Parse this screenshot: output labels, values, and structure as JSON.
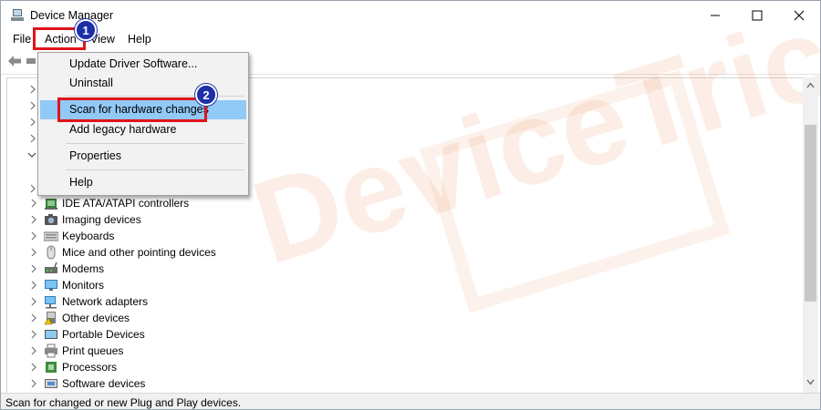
{
  "window": {
    "title": "Device Manager"
  },
  "window_controls": {
    "minimize": "—",
    "maximize": "☐",
    "close": "✕"
  },
  "menubar": {
    "items": [
      "File",
      "Action",
      "View",
      "Help"
    ]
  },
  "action_menu": {
    "items": [
      {
        "label": "Update Driver Software...",
        "highlighted": false
      },
      {
        "label": "Uninstall",
        "highlighted": false
      },
      {
        "label": "Scan for hardware changes",
        "highlighted": true
      },
      {
        "label": "Add legacy hardware",
        "highlighted": false
      },
      {
        "label": "Properties",
        "highlighted": false
      },
      {
        "label": "Help",
        "highlighted": false
      }
    ]
  },
  "callouts": {
    "step1": "1",
    "step2": "2"
  },
  "tree": {
    "items": [
      {
        "label": "IDE ATA/ATAPI controllers",
        "icon": "ide-controller-icon"
      },
      {
        "label": "Imaging devices",
        "icon": "camera-icon"
      },
      {
        "label": "Keyboards",
        "icon": "keyboard-icon"
      },
      {
        "label": "Mice and other pointing devices",
        "icon": "mouse-icon"
      },
      {
        "label": "Modems",
        "icon": "modem-icon"
      },
      {
        "label": "Monitors",
        "icon": "monitor-icon"
      },
      {
        "label": "Network adapters",
        "icon": "network-adapter-icon"
      },
      {
        "label": "Other devices",
        "icon": "other-device-warning-icon"
      },
      {
        "label": "Portable Devices",
        "icon": "portable-device-icon"
      },
      {
        "label": "Print queues",
        "icon": "printer-icon"
      },
      {
        "label": "Processors",
        "icon": "processor-icon"
      },
      {
        "label": "Software devices",
        "icon": "software-device-icon"
      }
    ]
  },
  "watermark": {
    "text": "DeviceTricks"
  },
  "statusbar": {
    "text": "Scan for changed or new Plug and Play devices."
  },
  "colors": {
    "highlight": "#91c9f7",
    "callout_red": "#e0141c",
    "badge_blue": "#1c2fa8"
  }
}
